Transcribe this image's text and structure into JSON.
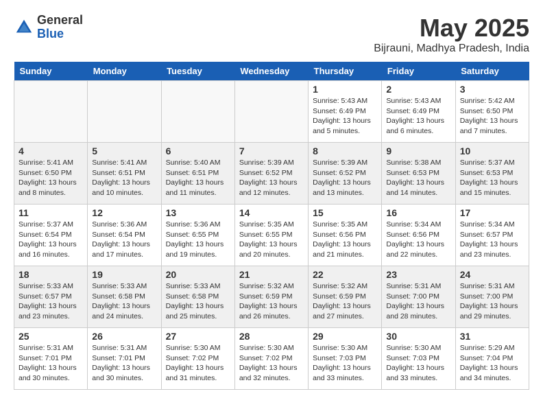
{
  "header": {
    "logo_general": "General",
    "logo_blue": "Blue",
    "month_title": "May 2025",
    "location": "Bijrauni, Madhya Pradesh, India"
  },
  "days_of_week": [
    "Sunday",
    "Monday",
    "Tuesday",
    "Wednesday",
    "Thursday",
    "Friday",
    "Saturday"
  ],
  "weeks": [
    [
      {
        "day": "",
        "info": ""
      },
      {
        "day": "",
        "info": ""
      },
      {
        "day": "",
        "info": ""
      },
      {
        "day": "",
        "info": ""
      },
      {
        "day": "1",
        "info": "Sunrise: 5:43 AM\nSunset: 6:49 PM\nDaylight: 13 hours\nand 5 minutes."
      },
      {
        "day": "2",
        "info": "Sunrise: 5:43 AM\nSunset: 6:49 PM\nDaylight: 13 hours\nand 6 minutes."
      },
      {
        "day": "3",
        "info": "Sunrise: 5:42 AM\nSunset: 6:50 PM\nDaylight: 13 hours\nand 7 minutes."
      }
    ],
    [
      {
        "day": "4",
        "info": "Sunrise: 5:41 AM\nSunset: 6:50 PM\nDaylight: 13 hours\nand 8 minutes."
      },
      {
        "day": "5",
        "info": "Sunrise: 5:41 AM\nSunset: 6:51 PM\nDaylight: 13 hours\nand 10 minutes."
      },
      {
        "day": "6",
        "info": "Sunrise: 5:40 AM\nSunset: 6:51 PM\nDaylight: 13 hours\nand 11 minutes."
      },
      {
        "day": "7",
        "info": "Sunrise: 5:39 AM\nSunset: 6:52 PM\nDaylight: 13 hours\nand 12 minutes."
      },
      {
        "day": "8",
        "info": "Sunrise: 5:39 AM\nSunset: 6:52 PM\nDaylight: 13 hours\nand 13 minutes."
      },
      {
        "day": "9",
        "info": "Sunrise: 5:38 AM\nSunset: 6:53 PM\nDaylight: 13 hours\nand 14 minutes."
      },
      {
        "day": "10",
        "info": "Sunrise: 5:37 AM\nSunset: 6:53 PM\nDaylight: 13 hours\nand 15 minutes."
      }
    ],
    [
      {
        "day": "11",
        "info": "Sunrise: 5:37 AM\nSunset: 6:54 PM\nDaylight: 13 hours\nand 16 minutes."
      },
      {
        "day": "12",
        "info": "Sunrise: 5:36 AM\nSunset: 6:54 PM\nDaylight: 13 hours\nand 17 minutes."
      },
      {
        "day": "13",
        "info": "Sunrise: 5:36 AM\nSunset: 6:55 PM\nDaylight: 13 hours\nand 19 minutes."
      },
      {
        "day": "14",
        "info": "Sunrise: 5:35 AM\nSunset: 6:55 PM\nDaylight: 13 hours\nand 20 minutes."
      },
      {
        "day": "15",
        "info": "Sunrise: 5:35 AM\nSunset: 6:56 PM\nDaylight: 13 hours\nand 21 minutes."
      },
      {
        "day": "16",
        "info": "Sunrise: 5:34 AM\nSunset: 6:56 PM\nDaylight: 13 hours\nand 22 minutes."
      },
      {
        "day": "17",
        "info": "Sunrise: 5:34 AM\nSunset: 6:57 PM\nDaylight: 13 hours\nand 23 minutes."
      }
    ],
    [
      {
        "day": "18",
        "info": "Sunrise: 5:33 AM\nSunset: 6:57 PM\nDaylight: 13 hours\nand 23 minutes."
      },
      {
        "day": "19",
        "info": "Sunrise: 5:33 AM\nSunset: 6:58 PM\nDaylight: 13 hours\nand 24 minutes."
      },
      {
        "day": "20",
        "info": "Sunrise: 5:33 AM\nSunset: 6:58 PM\nDaylight: 13 hours\nand 25 minutes."
      },
      {
        "day": "21",
        "info": "Sunrise: 5:32 AM\nSunset: 6:59 PM\nDaylight: 13 hours\nand 26 minutes."
      },
      {
        "day": "22",
        "info": "Sunrise: 5:32 AM\nSunset: 6:59 PM\nDaylight: 13 hours\nand 27 minutes."
      },
      {
        "day": "23",
        "info": "Sunrise: 5:31 AM\nSunset: 7:00 PM\nDaylight: 13 hours\nand 28 minutes."
      },
      {
        "day": "24",
        "info": "Sunrise: 5:31 AM\nSunset: 7:00 PM\nDaylight: 13 hours\nand 29 minutes."
      }
    ],
    [
      {
        "day": "25",
        "info": "Sunrise: 5:31 AM\nSunset: 7:01 PM\nDaylight: 13 hours\nand 30 minutes."
      },
      {
        "day": "26",
        "info": "Sunrise: 5:31 AM\nSunset: 7:01 PM\nDaylight: 13 hours\nand 30 minutes."
      },
      {
        "day": "27",
        "info": "Sunrise: 5:30 AM\nSunset: 7:02 PM\nDaylight: 13 hours\nand 31 minutes."
      },
      {
        "day": "28",
        "info": "Sunrise: 5:30 AM\nSunset: 7:02 PM\nDaylight: 13 hours\nand 32 minutes."
      },
      {
        "day": "29",
        "info": "Sunrise: 5:30 AM\nSunset: 7:03 PM\nDaylight: 13 hours\nand 33 minutes."
      },
      {
        "day": "30",
        "info": "Sunrise: 5:30 AM\nSunset: 7:03 PM\nDaylight: 13 hours\nand 33 minutes."
      },
      {
        "day": "31",
        "info": "Sunrise: 5:29 AM\nSunset: 7:04 PM\nDaylight: 13 hours\nand 34 minutes."
      }
    ]
  ]
}
